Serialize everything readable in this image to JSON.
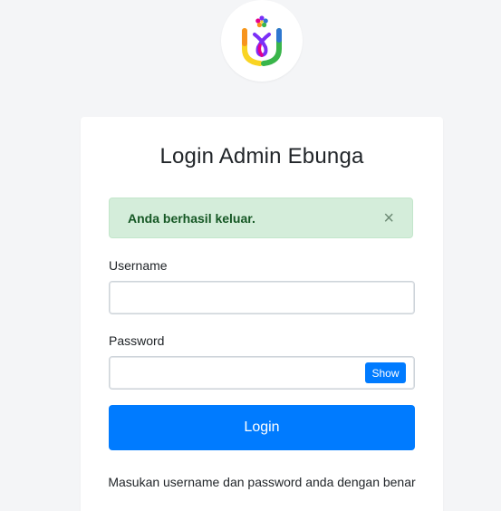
{
  "logo": {
    "icon": "ebunga-flower-logo-icon",
    "colors": {
      "purple": "#7b2ff7",
      "magenta": "#e4008c",
      "orange": "#f7941d",
      "yellow": "#f9d423",
      "green": "#39b54a",
      "blue": "#2e77d0"
    }
  },
  "login_card": {
    "title": "Login Admin Ebunga",
    "alert": {
      "message": "Anda berhasil keluar.",
      "close_symbol": "×",
      "close_icon": "close-icon",
      "background": "#d4edda",
      "text_color": "#155724"
    },
    "username": {
      "label": "Username",
      "value": "",
      "placeholder": ""
    },
    "password": {
      "label": "Password",
      "value": "",
      "placeholder": "",
      "toggle_label": "Show"
    },
    "submit_label": "Login",
    "helper_text": "Masukan username dan password anda dengan benar"
  },
  "colors": {
    "primary": "#007bff",
    "page_background": "#f4f5f7",
    "card_background": "#ffffff"
  }
}
